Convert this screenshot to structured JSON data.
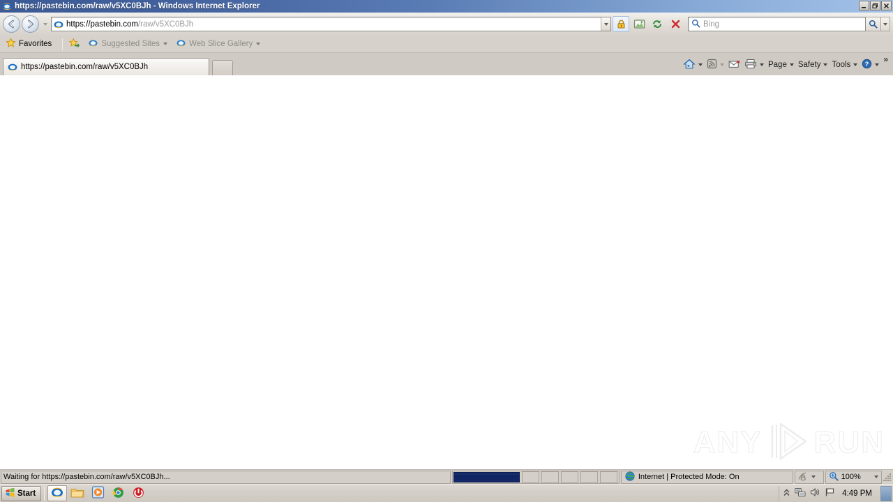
{
  "window": {
    "title": "https://pastebin.com/raw/v5XC0BJh - Windows Internet Explorer",
    "minimize_label": "Minimize",
    "restore_label": "Restore",
    "close_label": "Close"
  },
  "navbar": {
    "back_label": "Back",
    "forward_label": "Forward",
    "recent_pages_label": "Recent Pages",
    "address_host": "https://pastebin.com",
    "address_path": "/raw/v5XC0BJh",
    "address_full": "https://pastebin.com/raw/v5XC0BJh",
    "security_label": "Security Report (SSL)",
    "compatibility_label": "Compatibility View",
    "refresh_label": "Refresh",
    "stop_label": "Stop",
    "search_placeholder": "Bing",
    "search_go_label": "Search",
    "search_options_label": "Search Options"
  },
  "favorites_bar": {
    "favorites_label": "Favorites",
    "add_label": "Add to Favorites Bar",
    "items": [
      {
        "label": "Suggested Sites"
      },
      {
        "label": "Web Slice Gallery"
      }
    ]
  },
  "tabs": {
    "items": [
      {
        "title": "https://pastebin.com/raw/v5XC0BJh",
        "active": true
      }
    ],
    "new_tab_label": "New Tab"
  },
  "command_bar": {
    "home_label": "Home",
    "feeds_label": "Feeds",
    "mail_label": "Read Mail",
    "print_label": "Print",
    "items": [
      {
        "label": "Page"
      },
      {
        "label": "Safety"
      },
      {
        "label": "Tools"
      }
    ],
    "help_label": "Help",
    "overflow_label": "»"
  },
  "page": {
    "content": "",
    "watermark_left": "ANY",
    "watermark_right": "RUN"
  },
  "status_bar": {
    "status_text": "Waiting for https://pastebin.com/raw/v5XC0BJh...",
    "zone_text": "Internet | Protected Mode: On",
    "privacy_label": "Privacy Report",
    "zoom_level": "100%",
    "progress_filled_cells": 1,
    "progress_total_cells": 7
  },
  "taskbar": {
    "start_label": "Start",
    "apps": [
      {
        "name": "internet-explorer",
        "active": true
      },
      {
        "name": "windows-explorer",
        "active": false
      },
      {
        "name": "media-player",
        "active": false
      },
      {
        "name": "google-chrome",
        "active": false
      },
      {
        "name": "shutdown-tool",
        "active": false
      }
    ],
    "tray": {
      "show_hidden_label": "Show hidden icons",
      "network_label": "Network",
      "volume_label": "Volume",
      "action_center_label": "Action Center",
      "clock": "4:49 PM",
      "show_desktop_label": "Show desktop"
    }
  },
  "colors": {
    "title_bar_start": "#3c5a95",
    "title_bar_end": "#a3c2e8",
    "chrome_gray": "#d4cfc9",
    "progress_navy": "#0e2361",
    "page_bg": "#ffffff"
  }
}
